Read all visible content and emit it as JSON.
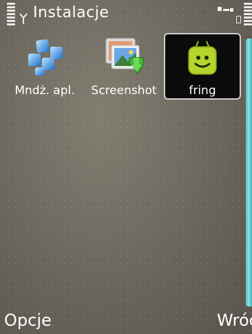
{
  "status_bar": {
    "title": "Instalacje",
    "signal_icon": "signal-strength-icon",
    "battery_icon": "battery-level-icon",
    "connection_icon": "connection-icon"
  },
  "apps": [
    {
      "label": "Mndż. apl.",
      "icon": "app-manager-icon"
    },
    {
      "label": "Screenshot",
      "icon": "screenshot-icon"
    },
    {
      "label": "fring",
      "icon": "fring-icon"
    }
  ],
  "softkeys": {
    "left": "Opcje",
    "right": "Wróć"
  },
  "colors": {
    "accent": "#4ec3c7",
    "selection_bg": "#0b0b0b",
    "fring_green": "#b5d42c"
  }
}
